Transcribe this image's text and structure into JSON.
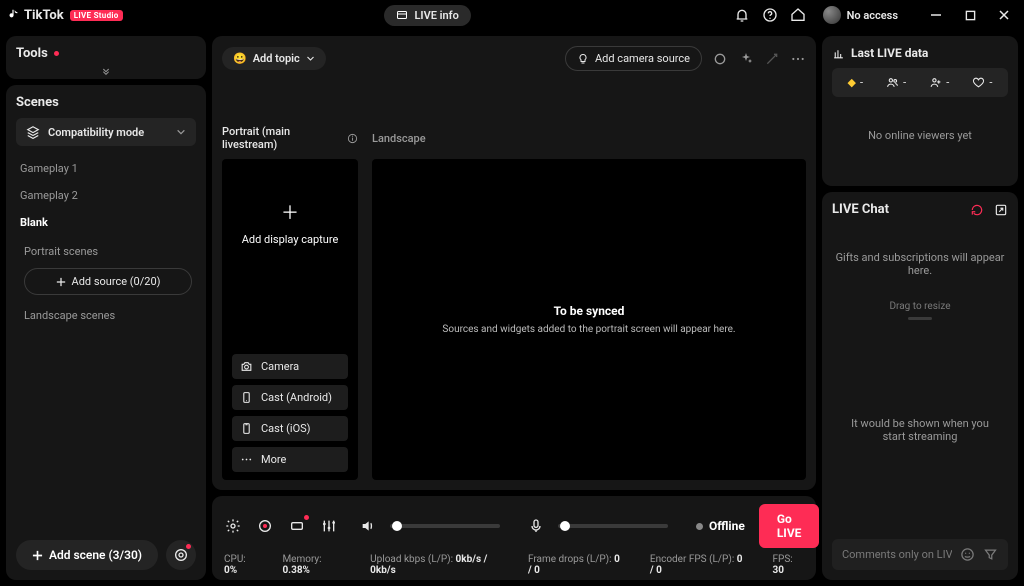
{
  "titlebar": {
    "app_name": "TikTok",
    "badge": "LIVE Studio",
    "live_info": "LIVE info",
    "username": "No access"
  },
  "tools": {
    "title": "Tools"
  },
  "scenes": {
    "title": "Scenes",
    "mode": "Compatibility mode",
    "items": [
      "Gameplay 1",
      "Gameplay 2",
      "Blank"
    ],
    "active_index": 2,
    "portrait_scenes_label": "Portrait scenes",
    "add_source": "Add source (0/20)",
    "landscape_scenes_label": "Landscape scenes",
    "add_scene": "Add scene (3/30)"
  },
  "center": {
    "add_topic": "Add topic",
    "add_camera_source": "Add camera source",
    "portrait_label": "Portrait (main livestream)",
    "landscape_label": "Landscape",
    "add_display_capture": "Add display capture",
    "options": {
      "camera": "Camera",
      "cast_android": "Cast (Android)",
      "cast_ios": "Cast (iOS)",
      "more": "More"
    },
    "sync_title": "To be synced",
    "sync_sub": "Sources and widgets added to the portrait screen will appear here."
  },
  "transport": {
    "offline": "Offline",
    "go_live": "Go LIVE",
    "stats": {
      "cpu_label": "CPU:",
      "cpu_val": "0%",
      "mem_label": "Memory:",
      "mem_val": "0.38%",
      "up_label": "Upload kbps (L/P):",
      "up_val": "0kb/s / 0kb/s",
      "fd_label": "Frame drops (L/P):",
      "fd_val": "0 / 0",
      "enc_label": "Encoder FPS (L/P):",
      "enc_val": "0 / 0",
      "fps_label": "FPS:",
      "fps_val": "30"
    }
  },
  "right": {
    "last_live_title": "Last LIVE data",
    "metrics_dash": "-",
    "no_viewers": "No online viewers yet",
    "chat_title": "LIVE Chat",
    "chat_gifts": "Gifts and subscriptions will appear here.",
    "drag_resize": "Drag to resize",
    "chat_empty": "It would be shown when you start streaming",
    "chat_placeholder": "Comments only on LIVE"
  }
}
